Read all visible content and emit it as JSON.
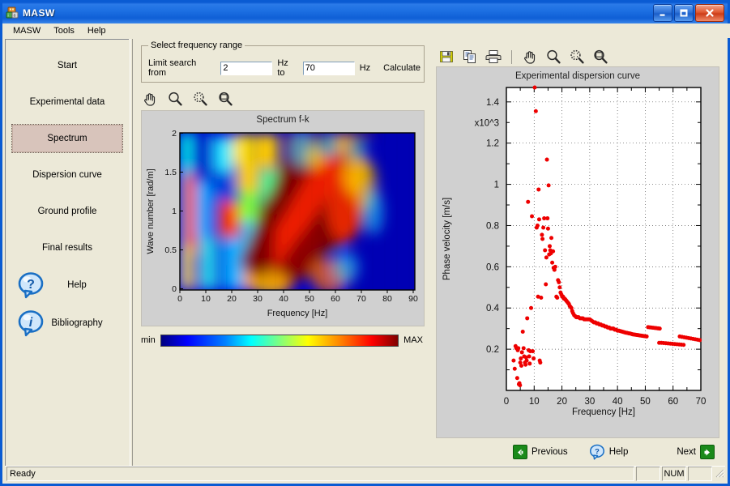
{
  "window": {
    "title": "MASW",
    "app_icon": "masw-app-icon",
    "minimize_label": "Minimize",
    "maximize_label": "Maximize",
    "close_label": "Close"
  },
  "menu": {
    "items": [
      {
        "label": "MASW"
      },
      {
        "label": "Tools"
      },
      {
        "label": "Help"
      }
    ]
  },
  "sidebar": {
    "items": [
      {
        "label": "Start",
        "selected": false
      },
      {
        "label": "Experimental data",
        "selected": false
      },
      {
        "label": "Spectrum",
        "selected": true
      },
      {
        "label": "Dispersion curve",
        "selected": false
      },
      {
        "label": "Ground profile",
        "selected": false
      },
      {
        "label": "Final results",
        "selected": false
      }
    ],
    "icon_items": [
      {
        "label": "Help",
        "icon": "question-balloon-icon"
      },
      {
        "label": "Bibliography",
        "icon": "info-balloon-icon"
      }
    ]
  },
  "frequency_range": {
    "group_title": "Select frequency range",
    "from_label": "Limit search from",
    "from_value": "2",
    "mid_label": "Hz to",
    "to_value": "70",
    "unit_label": "Hz",
    "calculate_label": "Calculate"
  },
  "left_toolbar": {
    "tools": [
      {
        "name": "pan-hand-icon",
        "title": "Pan"
      },
      {
        "name": "zoom-in-icon",
        "title": "Zoom in"
      },
      {
        "name": "zoom-out-icon",
        "title": "Zoom out"
      },
      {
        "name": "zoom-fit-icon",
        "title": "Zoom to fit"
      }
    ]
  },
  "right_toolbar": {
    "tools": [
      {
        "name": "save-icon",
        "title": "Save"
      },
      {
        "name": "copy-icon",
        "title": "Copy"
      },
      {
        "name": "print-icon",
        "title": "Print"
      },
      {
        "name": "pan-hand-icon",
        "title": "Pan"
      },
      {
        "name": "zoom-in-icon",
        "title": "Zoom in"
      },
      {
        "name": "zoom-out-icon",
        "title": "Zoom out"
      },
      {
        "name": "zoom-fit-icon",
        "title": "Zoom to fit"
      }
    ]
  },
  "colorbar": {
    "min_label": "min",
    "max_label": "MAX"
  },
  "navigation": {
    "previous_label": "Previous",
    "help_label": "Help",
    "next_label": "Next"
  },
  "statusbar": {
    "message": "Ready",
    "num_indicator": "NUM"
  },
  "chart_data": [
    {
      "id": "spectrum-fk",
      "type": "heatmap",
      "title": "Spectrum f-k",
      "xlabel": "Frequency [Hz]",
      "ylabel": "Wave number [rad/m]",
      "xlim": [
        0,
        90
      ],
      "ylim": [
        0,
        2.07
      ],
      "xticks": [
        0,
        10,
        20,
        30,
        40,
        50,
        60,
        70,
        80,
        90
      ],
      "yticks": [
        0,
        0.5,
        1,
        1.5,
        2
      ],
      "colormap": "jet",
      "colorbar": {
        "min_label": "min",
        "max_label": "MAX"
      },
      "grid": false,
      "description": "Frequency-wavenumber energy spectrum. High-energy (dark red) ridge runs diagonally from about (20 Hz, 0.2 rad/m) up to (55 Hz, 1.6 rad/m) and a broad saturated lobe fills 35-60 Hz between 0.4 and 2.0 rad/m. Energy decays to blue above 65 Hz."
    },
    {
      "id": "experimental-dispersion-curve",
      "type": "scatter",
      "title": "Experimental dispersion curve",
      "xlabel": "Frequency [Hz]",
      "ylabel": "Phase velocity [m/s]",
      "y_exponent_label": "x10^3",
      "xlim": [
        0,
        70
      ],
      "ylim": [
        0,
        1.47
      ],
      "xticks": [
        0,
        10,
        20,
        30,
        40,
        50,
        60,
        70
      ],
      "yticks": [
        0.2,
        0.4,
        0.6,
        0.8,
        1,
        1.2,
        1.4
      ],
      "minor_ytick_step": 0.1,
      "minor_xtick_step": 5,
      "grid": true,
      "marker_color": "#ee0000",
      "marker_size": 5,
      "points": [
        [
          2.6,
          0.145
        ],
        [
          3.0,
          0.105
        ],
        [
          3.3,
          0.215
        ],
        [
          3.6,
          0.205
        ],
        [
          3.9,
          0.06
        ],
        [
          4.1,
          0.195
        ],
        [
          4.3,
          0.205
        ],
        [
          4.5,
          0.03
        ],
        [
          4.7,
          0.035
        ],
        [
          4.9,
          0.025
        ],
        [
          5.0,
          0.135
        ],
        [
          5.2,
          0.155
        ],
        [
          5.4,
          0.12
        ],
        [
          5.6,
          0.185
        ],
        [
          5.9,
          0.285
        ],
        [
          6.2,
          0.205
        ],
        [
          6.4,
          0.165
        ],
        [
          6.7,
          0.135
        ],
        [
          6.9,
          0.125
        ],
        [
          7.1,
          0.16
        ],
        [
          7.3,
          0.145
        ],
        [
          7.5,
          0.35
        ],
        [
          7.8,
          0.915
        ],
        [
          8.0,
          0.195
        ],
        [
          8.2,
          0.165
        ],
        [
          8.4,
          0.13
        ],
        [
          8.6,
          0.19
        ],
        [
          8.9,
          0.4
        ],
        [
          9.2,
          0.845
        ],
        [
          9.5,
          0.19
        ],
        [
          9.8,
          0.155
        ],
        [
          10.2,
          1.47
        ],
        [
          10.6,
          1.355
        ],
        [
          10.9,
          0.79
        ],
        [
          11.2,
          0.8
        ],
        [
          11.4,
          0.455
        ],
        [
          11.6,
          0.975
        ],
        [
          11.8,
          0.83
        ],
        [
          12.0,
          0.145
        ],
        [
          12.2,
          0.135
        ],
        [
          12.5,
          0.45
        ],
        [
          12.8,
          0.755
        ],
        [
          13.0,
          0.735
        ],
        [
          13.3,
          0.79
        ],
        [
          13.6,
          0.835
        ],
        [
          13.9,
          0.68
        ],
        [
          14.2,
          0.515
        ],
        [
          14.4,
          0.645
        ],
        [
          14.6,
          1.12
        ],
        [
          14.8,
          0.835
        ],
        [
          15.0,
          0.785
        ],
        [
          15.2,
          0.995
        ],
        [
          15.4,
          0.66
        ],
        [
          15.6,
          0.7
        ],
        [
          15.8,
          0.68
        ],
        [
          16.0,
          0.665
        ],
        [
          16.2,
          0.74
        ],
        [
          16.5,
          0.62
        ],
        [
          16.8,
          0.675
        ],
        [
          17.0,
          0.595
        ],
        [
          17.3,
          0.585
        ],
        [
          17.6,
          0.6
        ],
        [
          18.0,
          0.455
        ],
        [
          18.3,
          0.45
        ],
        [
          18.6,
          0.535
        ],
        [
          18.9,
          0.525
        ],
        [
          19.2,
          0.5
        ],
        [
          19.5,
          0.475
        ],
        [
          19.8,
          0.465
        ],
        [
          20.1,
          0.455
        ],
        [
          20.4,
          0.455
        ],
        [
          20.7,
          0.445
        ],
        [
          21.0,
          0.445
        ],
        [
          21.3,
          0.44
        ],
        [
          21.6,
          0.435
        ],
        [
          21.9,
          0.43
        ],
        [
          22.2,
          0.425
        ],
        [
          22.5,
          0.42
        ],
        [
          22.8,
          0.41
        ],
        [
          23.1,
          0.405
        ],
        [
          23.4,
          0.4
        ],
        [
          23.7,
          0.385
        ],
        [
          24.0,
          0.375
        ],
        [
          24.4,
          0.365
        ],
        [
          24.8,
          0.36
        ],
        [
          25.2,
          0.355
        ],
        [
          25.6,
          0.355
        ],
        [
          26.0,
          0.355
        ],
        [
          26.5,
          0.35
        ],
        [
          27.0,
          0.35
        ],
        [
          27.5,
          0.35
        ],
        [
          28.0,
          0.345
        ],
        [
          28.5,
          0.345
        ],
        [
          29.0,
          0.345
        ],
        [
          29.5,
          0.345
        ],
        [
          30.0,
          0.345
        ],
        [
          30.5,
          0.34
        ],
        [
          31.0,
          0.335
        ],
        [
          31.5,
          0.33
        ],
        [
          32.0,
          0.33
        ],
        [
          32.5,
          0.325
        ],
        [
          33.0,
          0.325
        ],
        [
          33.5,
          0.32
        ],
        [
          34.0,
          0.32
        ],
        [
          34.5,
          0.315
        ],
        [
          35.0,
          0.315
        ],
        [
          35.5,
          0.31
        ],
        [
          36.0,
          0.31
        ],
        [
          36.5,
          0.305
        ],
        [
          37.0,
          0.305
        ],
        [
          37.5,
          0.3
        ],
        [
          38.0,
          0.3
        ],
        [
          38.5,
          0.3
        ],
        [
          39.0,
          0.295
        ],
        [
          39.5,
          0.295
        ],
        [
          40.0,
          0.29
        ],
        [
          40.5,
          0.29
        ],
        [
          41.0,
          0.288
        ],
        [
          41.5,
          0.286
        ],
        [
          42.0,
          0.284
        ],
        [
          42.5,
          0.282
        ],
        [
          43.0,
          0.28
        ],
        [
          43.5,
          0.279
        ],
        [
          44.0,
          0.277
        ],
        [
          44.5,
          0.276
        ],
        [
          45.0,
          0.274
        ],
        [
          45.5,
          0.272
        ],
        [
          46.0,
          0.271
        ],
        [
          46.5,
          0.27
        ],
        [
          47.0,
          0.269
        ],
        [
          47.5,
          0.268
        ],
        [
          48.0,
          0.267
        ],
        [
          48.5,
          0.266
        ],
        [
          49.0,
          0.265
        ],
        [
          49.5,
          0.264
        ],
        [
          50.0,
          0.263
        ],
        [
          50.5,
          0.262
        ],
        [
          51.0,
          0.307
        ],
        [
          51.6,
          0.306
        ],
        [
          52.2,
          0.305
        ],
        [
          52.8,
          0.304
        ],
        [
          53.4,
          0.303
        ],
        [
          54.0,
          0.302
        ],
        [
          54.6,
          0.301
        ],
        [
          55.2,
          0.3
        ],
        [
          55.0,
          0.231
        ],
        [
          55.8,
          0.231
        ],
        [
          56.6,
          0.23
        ],
        [
          57.4,
          0.229
        ],
        [
          58.2,
          0.228
        ],
        [
          59.0,
          0.227
        ],
        [
          59.8,
          0.226
        ],
        [
          60.6,
          0.225
        ],
        [
          61.4,
          0.224
        ],
        [
          62.2,
          0.223
        ],
        [
          63.0,
          0.222
        ],
        [
          63.8,
          0.221
        ],
        [
          62.4,
          0.262
        ],
        [
          63.2,
          0.26
        ],
        [
          64.0,
          0.258
        ],
        [
          64.8,
          0.256
        ],
        [
          65.6,
          0.254
        ],
        [
          66.4,
          0.252
        ],
        [
          67.2,
          0.25
        ],
        [
          68.0,
          0.248
        ],
        [
          68.8,
          0.246
        ],
        [
          69.6,
          0.244
        ]
      ]
    }
  ]
}
